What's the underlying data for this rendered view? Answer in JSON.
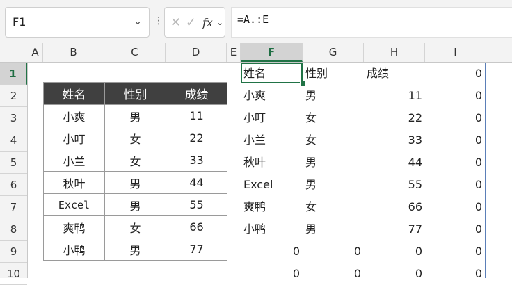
{
  "formula_bar": {
    "name_box": "F1",
    "formula": "=A.:E"
  },
  "icons": {
    "name_box_dropdown": "chevron-down-icon",
    "more": "vertical-ellipsis-icon",
    "cancel": "x-icon",
    "confirm": "check-icon",
    "function": "fx-icon"
  },
  "columns": [
    "A",
    "B",
    "C",
    "D",
    "E",
    "F",
    "G",
    "H",
    "I"
  ],
  "rows": [
    "1",
    "2",
    "3",
    "4",
    "5",
    "6",
    "7",
    "8",
    "9",
    "10"
  ],
  "selected": {
    "column": "F",
    "row": "1"
  },
  "table_left": {
    "headers": [
      "姓名",
      "性别",
      "成绩"
    ],
    "rows": [
      [
        "小爽",
        "男",
        "11"
      ],
      [
        "小叮",
        "女",
        "22"
      ],
      [
        "小兰",
        "女",
        "33"
      ],
      [
        "秋叶",
        "男",
        "44"
      ],
      [
        "Excel",
        "男",
        "55"
      ],
      [
        "爽鸭",
        "女",
        "66"
      ],
      [
        "小鸭",
        "男",
        "77"
      ]
    ]
  },
  "spill": {
    "rows": [
      [
        "姓名",
        "性别",
        "成绩",
        "0"
      ],
      [
        "小爽",
        "男",
        "11",
        "0"
      ],
      [
        "小叮",
        "女",
        "22",
        "0"
      ],
      [
        "小兰",
        "女",
        "33",
        "0"
      ],
      [
        "秋叶",
        "男",
        "44",
        "0"
      ],
      [
        "Excel",
        "男",
        "55",
        "0"
      ],
      [
        "爽鸭",
        "女",
        "66",
        "0"
      ],
      [
        "小鸭",
        "男",
        "77",
        "0"
      ],
      [
        "0",
        "0",
        "0",
        "0"
      ],
      [
        "0",
        "0",
        "0",
        "0"
      ]
    ]
  },
  "colors": {
    "header_fill": "#404040",
    "selection": "#217346",
    "spill_border": "#5b7fb8"
  }
}
